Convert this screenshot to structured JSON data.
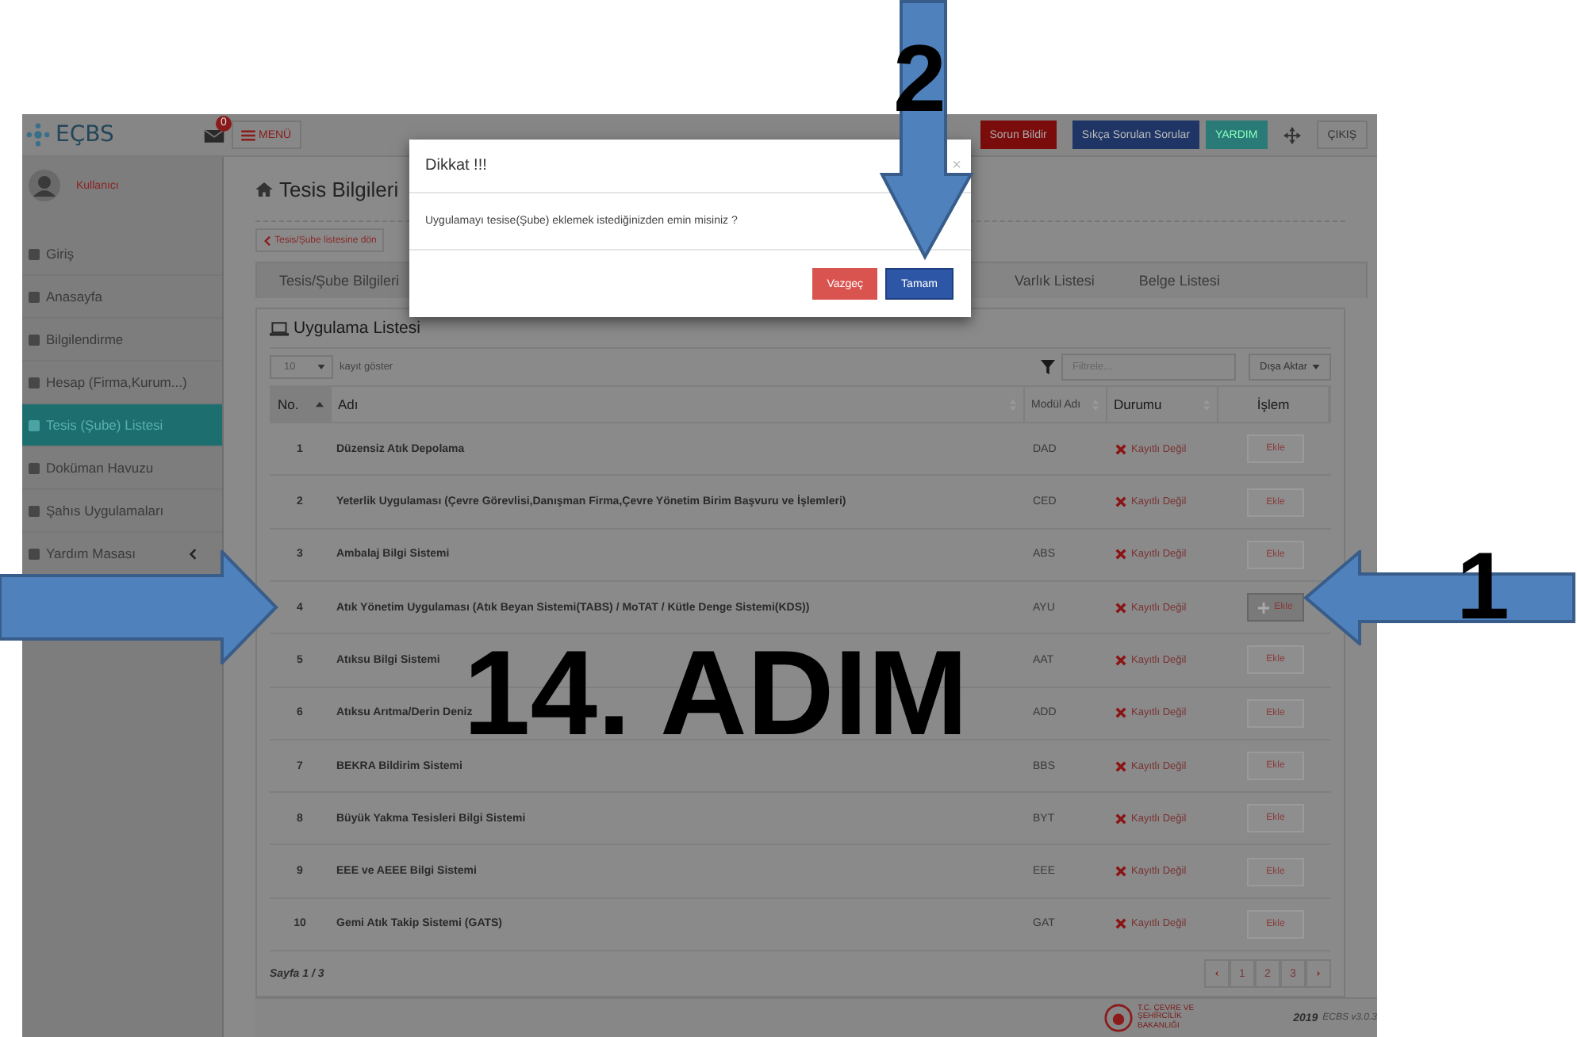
{
  "header": {
    "logo": "EÇBS",
    "mail_badge": "0",
    "menu_button": "MENÜ",
    "buttons": [
      {
        "label": "Sorun Bildir",
        "kind": "report"
      },
      {
        "label": "Sıkça Sorulan Sorular",
        "kind": "faq"
      },
      {
        "label": "YARDIM",
        "kind": "help"
      }
    ],
    "logout": "ÇIKIŞ"
  },
  "sidebar": {
    "user": "Kullanıcı",
    "items": [
      {
        "label": "Giriş",
        "selected": false,
        "expandable": false
      },
      {
        "label": "Anasayfa",
        "selected": false,
        "expandable": false
      },
      {
        "label": "Bilgilendirme",
        "selected": false,
        "expandable": false
      },
      {
        "label": "Hesap (Firma,Kurum...)",
        "selected": false,
        "expandable": false
      },
      {
        "label": "Tesis (Şube) Listesi",
        "selected": true,
        "expandable": false
      },
      {
        "label": "Doküman Havuzu",
        "selected": false,
        "expandable": false
      },
      {
        "label": "Şahıs Uygulamaları",
        "selected": false,
        "expandable": false
      },
      {
        "label": "Yardım Masası",
        "selected": false,
        "expandable": true
      }
    ]
  },
  "main": {
    "title": "Tesis Bilgileri",
    "back_button": "Tesis/Şube listesine dön",
    "tabs": [
      {
        "label": "Tesis/Şube Bilgileri",
        "selected": false
      },
      {
        "label": "Varlık Listesi",
        "selected": false
      },
      {
        "label": "Belge Listesi",
        "selected": false
      }
    ],
    "panel": {
      "title": "Uygulama Listesi",
      "page_size": "10",
      "page_size_label": "kayıt göster",
      "filter": {
        "placeholder": "Filtrele..."
      },
      "export_button": "Dışa Aktar",
      "columns": [
        {
          "label": "No.",
          "sortable": true,
          "sorted": true
        },
        {
          "label": "Adı",
          "sortable": true,
          "sorted": false
        },
        {
          "label": "Modül Adı",
          "sortable": true,
          "sorted": false
        },
        {
          "label": "Durumu",
          "sortable": true,
          "sorted": false
        },
        {
          "label": "İşlem",
          "sortable": false,
          "sorted": false
        }
      ],
      "rows": [
        {
          "no": "1",
          "name": "Düzensiz Atık Depolama",
          "module": "DAD",
          "status": "Kayıtlı Değil",
          "action": "Ekle",
          "highlighted": false
        },
        {
          "no": "2",
          "name": "Yeterlik Uygulaması (Çevre Görevlisi,Danışman Firma,Çevre Yönetim Birim Başvuru ve İşlemleri)",
          "module": "CED",
          "status": "Kayıtlı Değil",
          "action": "Ekle",
          "highlighted": false
        },
        {
          "no": "3",
          "name": "Ambalaj Bilgi Sistemi",
          "module": "ABS",
          "status": "Kayıtlı Değil",
          "action": "Ekle",
          "highlighted": false
        },
        {
          "no": "4",
          "name": "Atık Yönetim Uygulaması (Atık Beyan Sistemi(TABS) / MoTAT / Kütle Denge Sistemi(KDS))",
          "module": "AYU",
          "status": "Kayıtlı Değil",
          "action": "Ekle",
          "highlighted": true
        },
        {
          "no": "5",
          "name": "Atıksu Bilgi Sistemi",
          "module": "AAT",
          "status": "Kayıtlı Değil",
          "action": "Ekle",
          "highlighted": false
        },
        {
          "no": "6",
          "name": "Atıksu Arıtma/Derin Deniz",
          "module": "ADD",
          "status": "Kayıtlı Değil",
          "action": "Ekle",
          "highlighted": false
        },
        {
          "no": "7",
          "name": "BEKRA Bildirim Sistemi",
          "module": "BBS",
          "status": "Kayıtlı Değil",
          "action": "Ekle",
          "highlighted": false
        },
        {
          "no": "8",
          "name": "Büyük Yakma Tesisleri Bilgi Sistemi",
          "module": "BYT",
          "status": "Kayıtlı Değil",
          "action": "Ekle",
          "highlighted": false
        },
        {
          "no": "9",
          "name": "EEE ve AEEE Bilgi Sistemi",
          "module": "EEE",
          "status": "Kayıtlı Değil",
          "action": "Ekle",
          "highlighted": false
        },
        {
          "no": "10",
          "name": "Gemi Atık Takip Sistemi (GATS)",
          "module": "GAT",
          "status": "Kayıtlı Değil",
          "action": "Ekle",
          "highlighted": false
        }
      ],
      "page_info": "Sayfa 1 / 3",
      "pages": [
        "1",
        "2",
        "3"
      ]
    },
    "footer": {
      "ministry": "T.C. ÇEVRE VE ŞEHİRCİLİK BAKANLIĞI",
      "year": "2019",
      "version": "ECBS v3.0.3"
    }
  },
  "modal": {
    "title": "Dikkat !!!",
    "close": "×",
    "message": "Uygulamayı tesise(Şube) eklemek istediğinizden emin misiniz ?",
    "buttons": [
      {
        "label": "Vazgeç",
        "kind": "cancel"
      },
      {
        "label": "Tamam",
        "kind": "confirm"
      }
    ]
  },
  "annotations": {
    "step_title": "14. ADIM",
    "markers": [
      "2",
      "1"
    ]
  }
}
